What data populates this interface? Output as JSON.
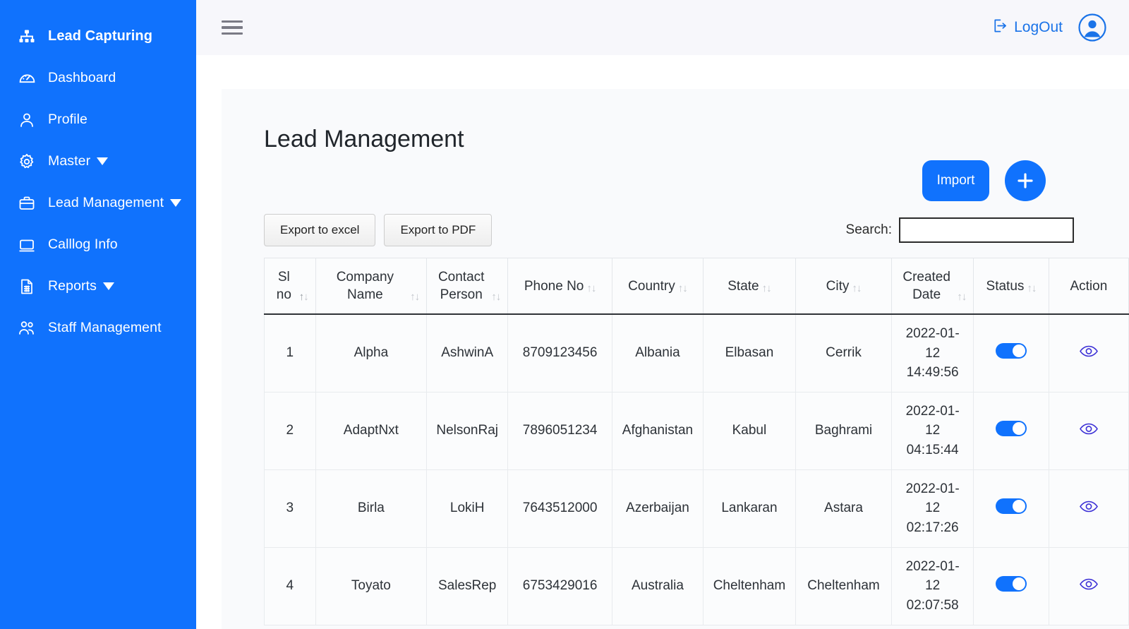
{
  "sidebar": {
    "brand": {
      "label": "Lead Capturing",
      "icon": "sitemap-icon"
    },
    "items": [
      {
        "label": "Dashboard",
        "icon": "gauge-icon",
        "caret": false
      },
      {
        "label": "Profile",
        "icon": "user-icon",
        "caret": false
      },
      {
        "label": "Master",
        "icon": "gear-icon",
        "caret": true
      },
      {
        "label": "Lead Management",
        "icon": "briefcase-icon",
        "caret": true
      },
      {
        "label": "Calllog Info",
        "icon": "laptop-icon",
        "caret": false
      },
      {
        "label": "Reports",
        "icon": "document-icon",
        "caret": true
      },
      {
        "label": "Staff Management",
        "icon": "users-icon",
        "caret": false
      }
    ],
    "bg_color": "#1072fd"
  },
  "topbar": {
    "menu_icon": "hamburger-icon",
    "logout_label": "LogOut",
    "logout_icon": "logout-icon",
    "avatar_icon": "user-avatar-icon",
    "accent_color": "#1a73e8"
  },
  "page": {
    "title": "Lead Management",
    "import_label": "Import",
    "add_label": "+",
    "export_excel_label": "Export to excel",
    "export_pdf_label": "Export to PDF",
    "search_label": "Search:",
    "search_value": "",
    "search_placeholder": ""
  },
  "table": {
    "columns": [
      {
        "label": "Sl no",
        "sort": "asc"
      },
      {
        "label": "Company Name",
        "sort": "none"
      },
      {
        "label": "Contact Person",
        "sort": "none"
      },
      {
        "label": "Phone No",
        "sort": "none"
      },
      {
        "label": "Country",
        "sort": "none"
      },
      {
        "label": "State",
        "sort": "none"
      },
      {
        "label": "City",
        "sort": "none"
      },
      {
        "label": "Created Date",
        "sort": "none"
      },
      {
        "label": "Status",
        "sort": "none"
      },
      {
        "label": "Action",
        "sort": "none"
      }
    ],
    "rows": [
      {
        "sl": "1",
        "company": "Alpha",
        "contact": "AshwinA",
        "phone": "8709123456",
        "country": "Albania",
        "state": "Elbasan",
        "city": "Cerrik",
        "date": "2022-01-12 14:49:56",
        "status": "on",
        "action_icon": "eye-icon"
      },
      {
        "sl": "2",
        "company": "AdaptNxt",
        "contact": "NelsonRaj",
        "phone": "7896051234",
        "country": "Afghanistan",
        "state": "Kabul",
        "city": "Baghrami",
        "date": "2022-01-12 04:15:44",
        "status": "on",
        "action_icon": "eye-icon"
      },
      {
        "sl": "3",
        "company": "Birla",
        "contact": "LokiH",
        "phone": "7643512000",
        "country": "Azerbaijan",
        "state": "Lankaran",
        "city": "Astara",
        "date": "2022-01-12 02:17:26",
        "status": "on",
        "action_icon": "eye-icon"
      },
      {
        "sl": "4",
        "company": "Toyato",
        "contact": "SalesRep",
        "phone": "6753429016",
        "country": "Australia",
        "state": "Cheltenham",
        "city": "Cheltenham",
        "date": "2022-01-12 02:07:58",
        "status": "on",
        "action_icon": "eye-icon"
      }
    ]
  },
  "colors": {
    "primary": "#1072fd",
    "topbar_bg": "#f7f7fb",
    "card_bg": "#f9fafc",
    "eye_icon": "#3b2fd6"
  }
}
